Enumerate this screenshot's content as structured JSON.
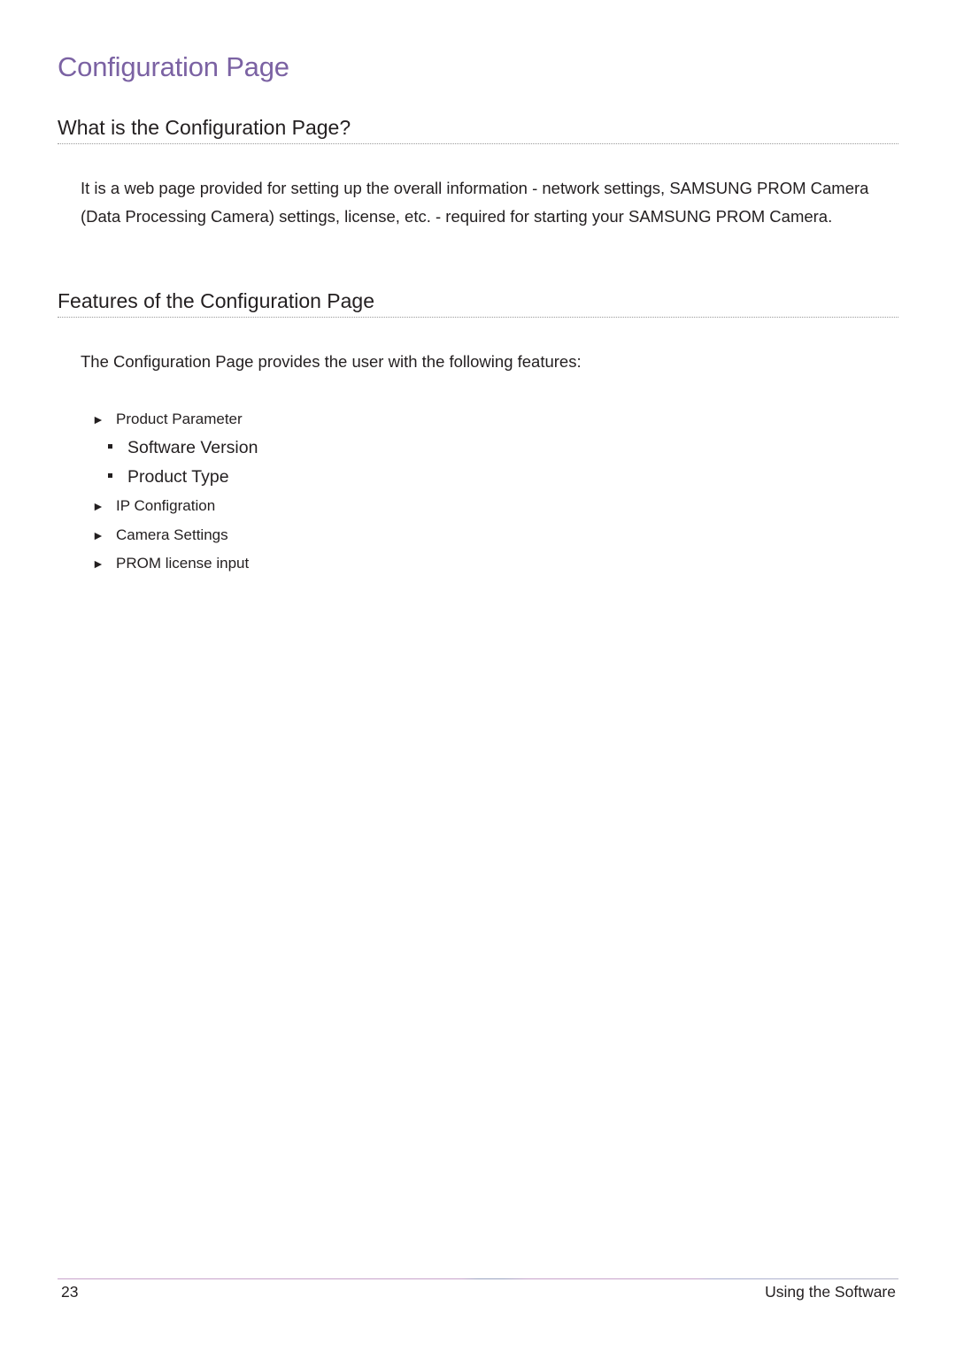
{
  "page": {
    "title": "Configuration Page"
  },
  "sections": [
    {
      "heading": "What is the Configuration Page?",
      "paragraph": "It is a web page provided for setting up the overall information - network settings, SAMSUNG PROM Camera (Data Processing Camera) settings, license, etc. - required for starting your SAMSUNG PROM Camera."
    },
    {
      "heading": "Features of the Configuration Page",
      "paragraph": "The Configuration Page provides the user with the following features:",
      "features": [
        {
          "label": "Product Parameter",
          "subitems": [
            "Software Version",
            "Product Type"
          ]
        },
        {
          "label": "IP Configration",
          "subitems": []
        },
        {
          "label": "Camera Settings",
          "subitems": []
        },
        {
          "label": "PROM license input",
          "subitems": []
        }
      ]
    }
  ],
  "icons": {
    "bullet_arrow": "►",
    "bullet_square": "square-bullet"
  },
  "footer": {
    "page_number": "23",
    "section_name": "Using the Software"
  },
  "colors": {
    "title_accent": "#7b62a3",
    "text": "#231f20",
    "footer_rule": "#c9a3cc"
  }
}
